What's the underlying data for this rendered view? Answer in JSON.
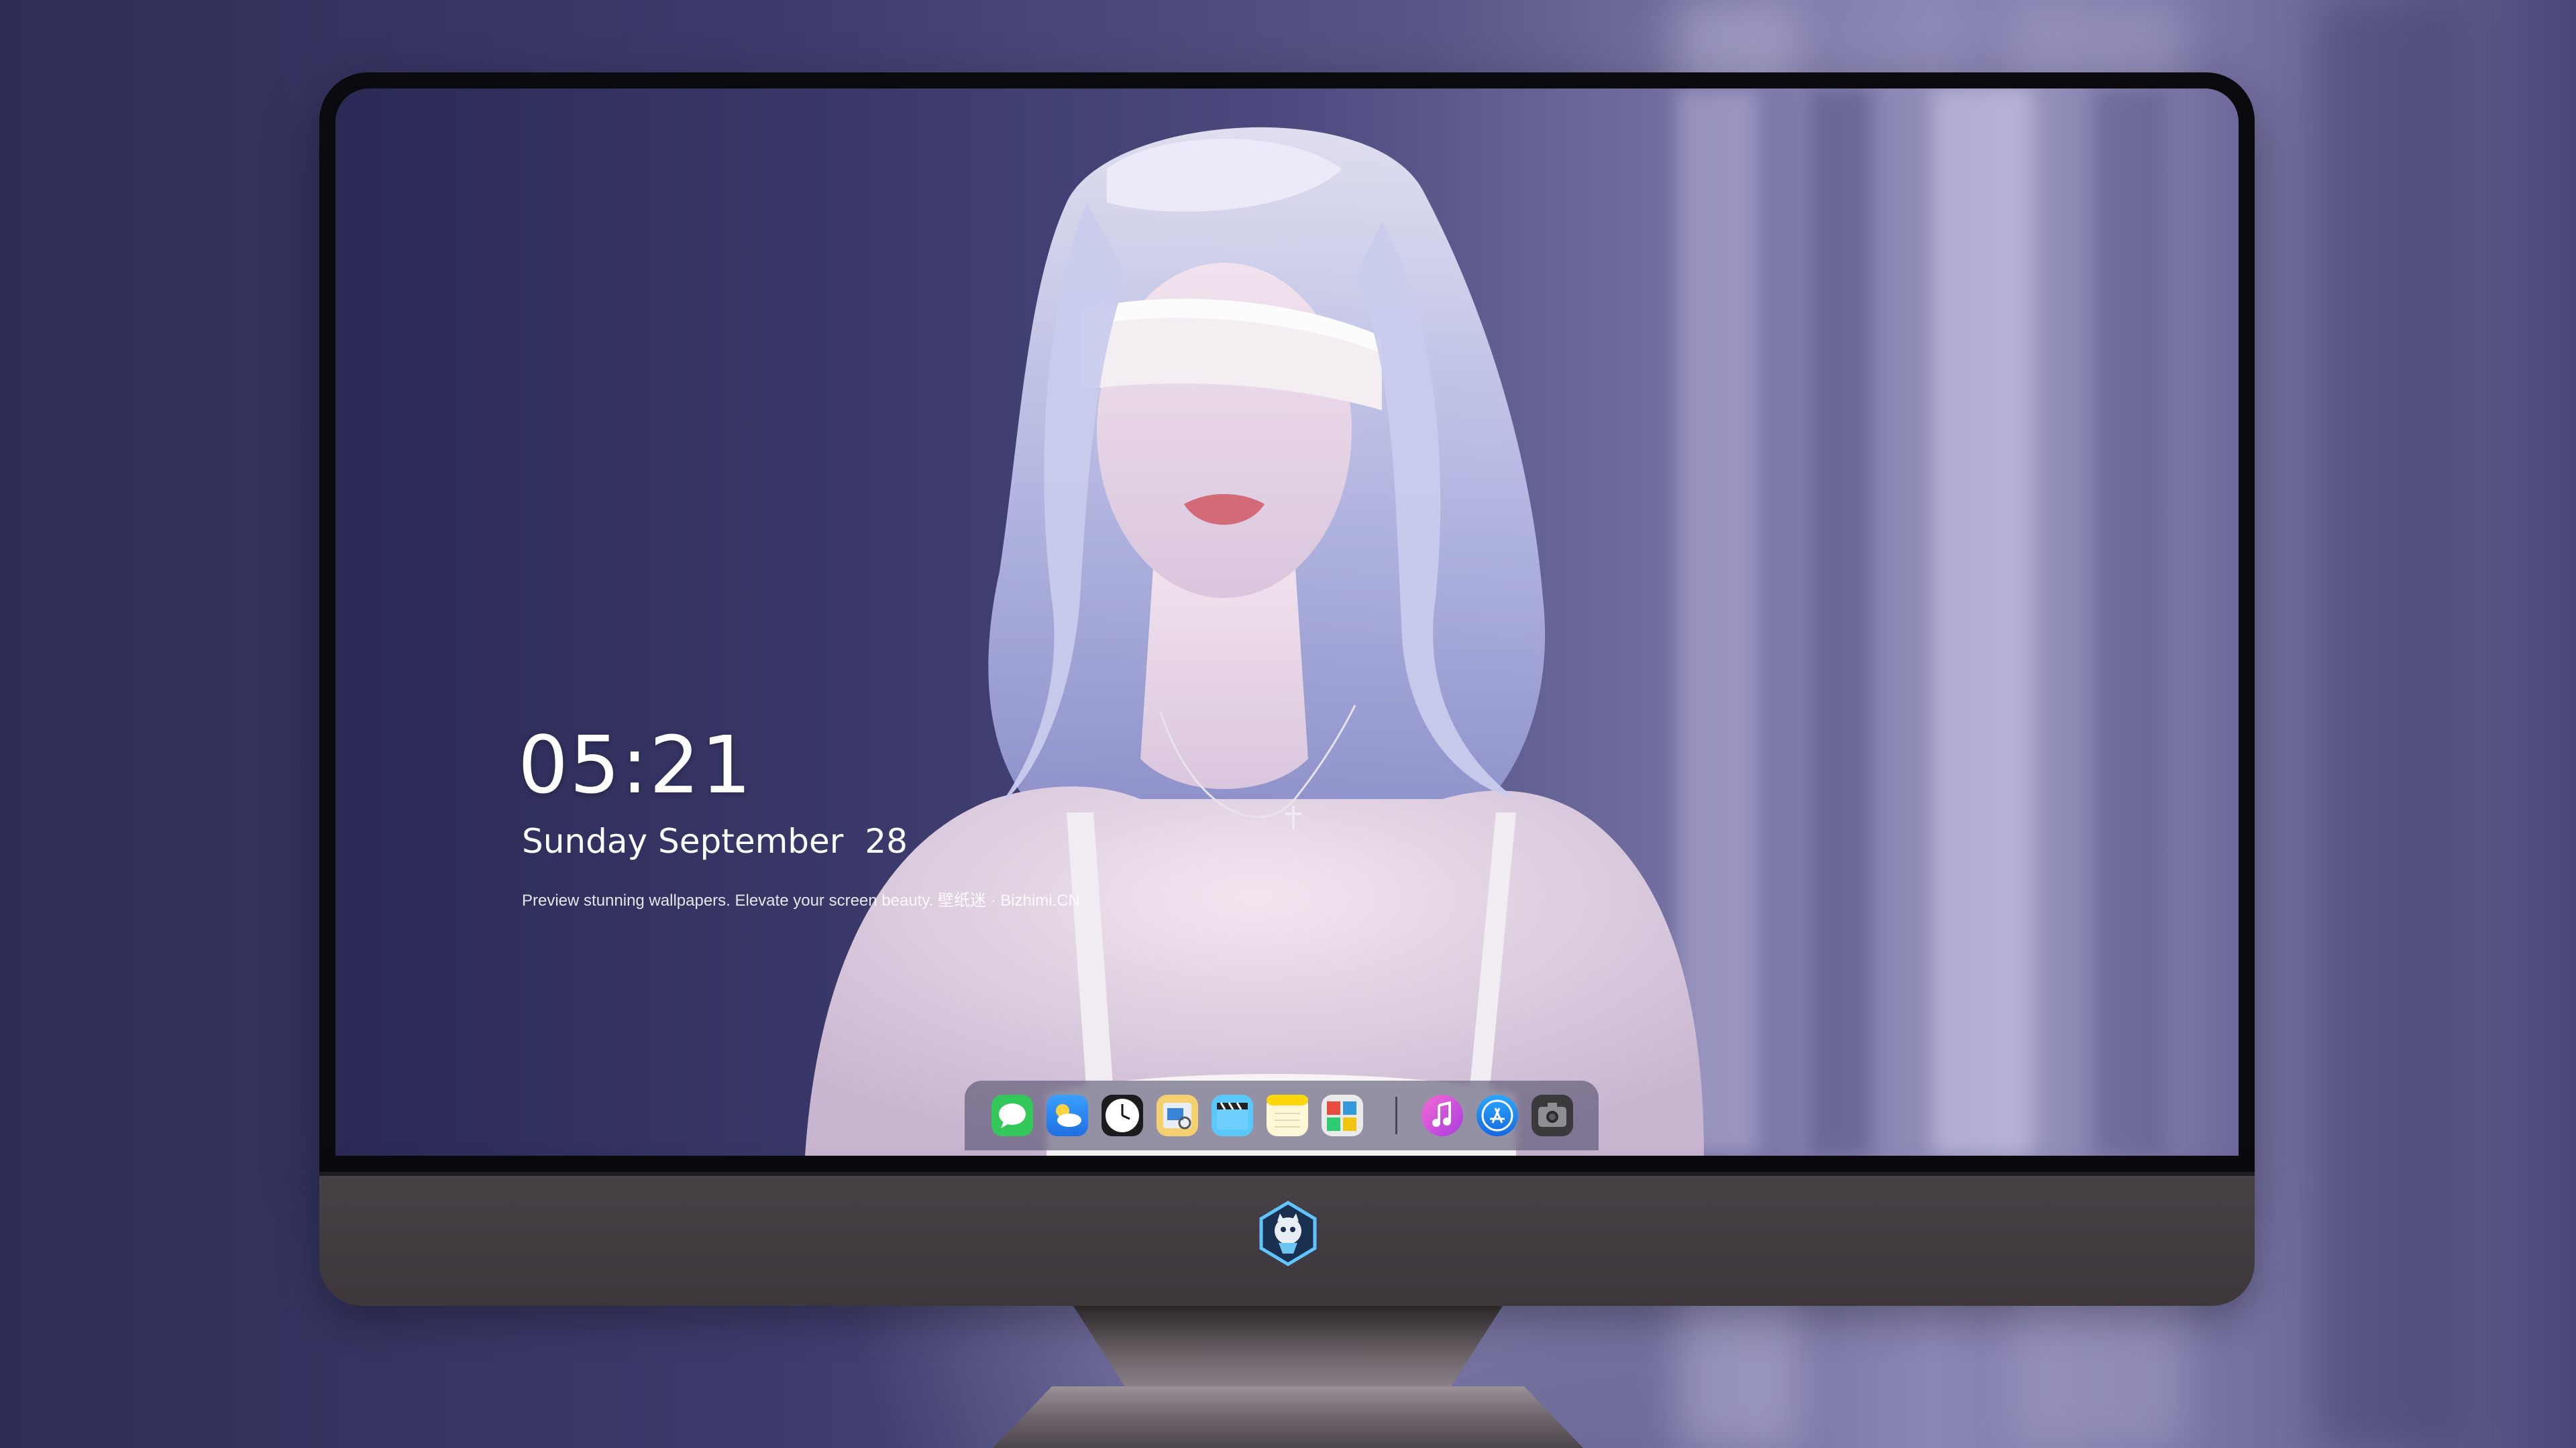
{
  "lock_screen": {
    "time": "05:21",
    "weekday": "Sunday",
    "month": "September",
    "day": "28",
    "tagline": "Preview stunning wallpapers. Elevate your screen beauty. 壁纸迷 · Bizhimi.CN"
  },
  "dock": {
    "apps": [
      {
        "name": "messages-icon",
        "color": "#34c759"
      },
      {
        "name": "weather-icon",
        "color": "#2f8cf0"
      },
      {
        "name": "clock-icon",
        "color": "#ffffff"
      },
      {
        "name": "preview-icon",
        "color": "#e8c46a"
      },
      {
        "name": "clips-icon",
        "color": "#5ac8fa"
      },
      {
        "name": "notes-icon",
        "color": "#ffd60a"
      },
      {
        "name": "photo-booth-icon",
        "color": "#e0e0e0"
      },
      {
        "name": "music-icon",
        "color": "#d94dd8"
      },
      {
        "name": "app-store-icon",
        "color": "#1e8cf5"
      },
      {
        "name": "camera-icon",
        "color": "#8e8e93"
      }
    ]
  },
  "colors": {
    "wallpaper_base": "#383767",
    "bezel": "#0b0b0f",
    "chin": "#484146"
  }
}
